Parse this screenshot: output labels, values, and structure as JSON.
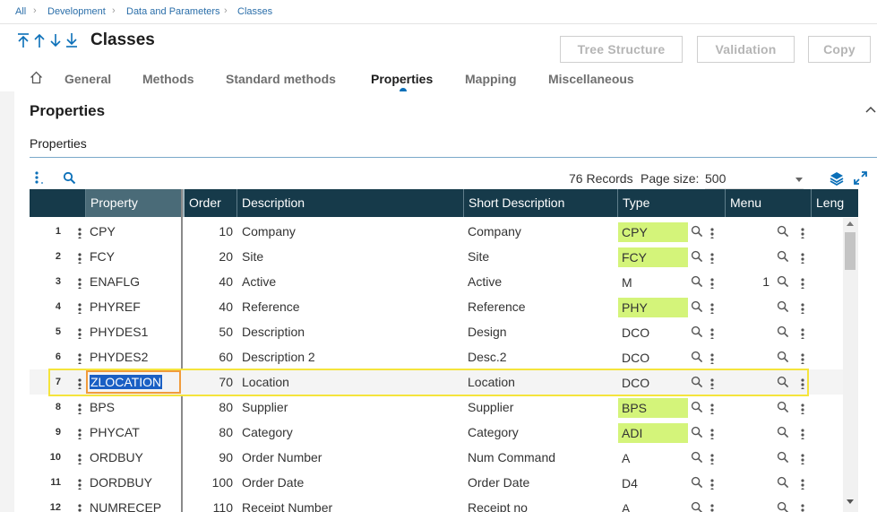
{
  "breadcrumb": [
    "All",
    "Development",
    "Data and Parameters",
    "Classes"
  ],
  "page": {
    "title": "Classes"
  },
  "header_buttons": {
    "tree_structure": "Tree Structure",
    "validation": "Validation",
    "copy": "Copy"
  },
  "tabs": [
    "General",
    "Methods",
    "Standard methods",
    "Properties",
    "Mapping",
    "Miscellaneous"
  ],
  "active_tab": "Properties",
  "section": {
    "title": "Properties",
    "subtitle": "Properties"
  },
  "toolbar": {
    "records": "76 Records",
    "page_size_label": "Page size:",
    "page_size_value": "500"
  },
  "grid": {
    "columns": [
      "Property",
      "Order",
      "Description",
      "Short Description",
      "Type",
      "Menu",
      "Leng"
    ],
    "rows": [
      {
        "num": "1",
        "property": "CPY",
        "order": "10",
        "description": "Company",
        "short": "Company",
        "type": "CPY",
        "type_highlight": true,
        "menu": ""
      },
      {
        "num": "2",
        "property": "FCY",
        "order": "20",
        "description": "Site",
        "short": "Site",
        "type": "FCY",
        "type_highlight": true,
        "menu": ""
      },
      {
        "num": "3",
        "property": "ENAFLG",
        "order": "40",
        "description": "Active",
        "short": "Active",
        "type": "M",
        "type_highlight": false,
        "menu": "1"
      },
      {
        "num": "4",
        "property": "PHYREF",
        "order": "40",
        "description": "Reference",
        "short": "Reference",
        "type": "PHY",
        "type_highlight": true,
        "menu": ""
      },
      {
        "num": "5",
        "property": "PHYDES1",
        "order": "50",
        "description": "Description",
        "short": "Design",
        "type": "DCO",
        "type_highlight": false,
        "menu": ""
      },
      {
        "num": "6",
        "property": "PHYDES2",
        "order": "60",
        "description": "Description 2",
        "short": "Desc.2",
        "type": "DCO",
        "type_highlight": false,
        "menu": ""
      },
      {
        "num": "7",
        "property": "ZLOCATION",
        "order": "70",
        "description": "Location",
        "short": "Location",
        "type": "DCO",
        "type_highlight": false,
        "menu": ""
      },
      {
        "num": "8",
        "property": "BPS",
        "order": "80",
        "description": "Supplier",
        "short": "Supplier",
        "type": "BPS",
        "type_highlight": true,
        "menu": ""
      },
      {
        "num": "9",
        "property": "PHYCAT",
        "order": "80",
        "description": "Category",
        "short": "Category",
        "type": "ADI",
        "type_highlight": true,
        "menu": ""
      },
      {
        "num": "10",
        "property": "ORDBUY",
        "order": "90",
        "description": "Order Number",
        "short": "Num Command",
        "type": "A",
        "type_highlight": false,
        "menu": ""
      },
      {
        "num": "11",
        "property": "DORDBUY",
        "order": "100",
        "description": "Order Date",
        "short": "Order Date",
        "type": "D4",
        "type_highlight": false,
        "menu": ""
      },
      {
        "num": "12",
        "property": "NUMRECEP",
        "order": "110",
        "description": "Receipt Number",
        "short": "Receipt no",
        "type": "A",
        "type_highlight": false,
        "menu": ""
      }
    ]
  },
  "colors": {
    "header_bg": "#163a4a",
    "accent": "#0a6fb8",
    "type_highlight": "#d4f47a",
    "selection_border": "#f5e43c",
    "cell_focus": "#f09b3c"
  },
  "icons": [
    "home-icon",
    "arrow-first-icon",
    "arrow-up-icon",
    "arrow-down-icon",
    "arrow-last-icon",
    "kebab-icon",
    "search-icon",
    "layers-icon",
    "expand-icon",
    "chevron-up-icon"
  ]
}
